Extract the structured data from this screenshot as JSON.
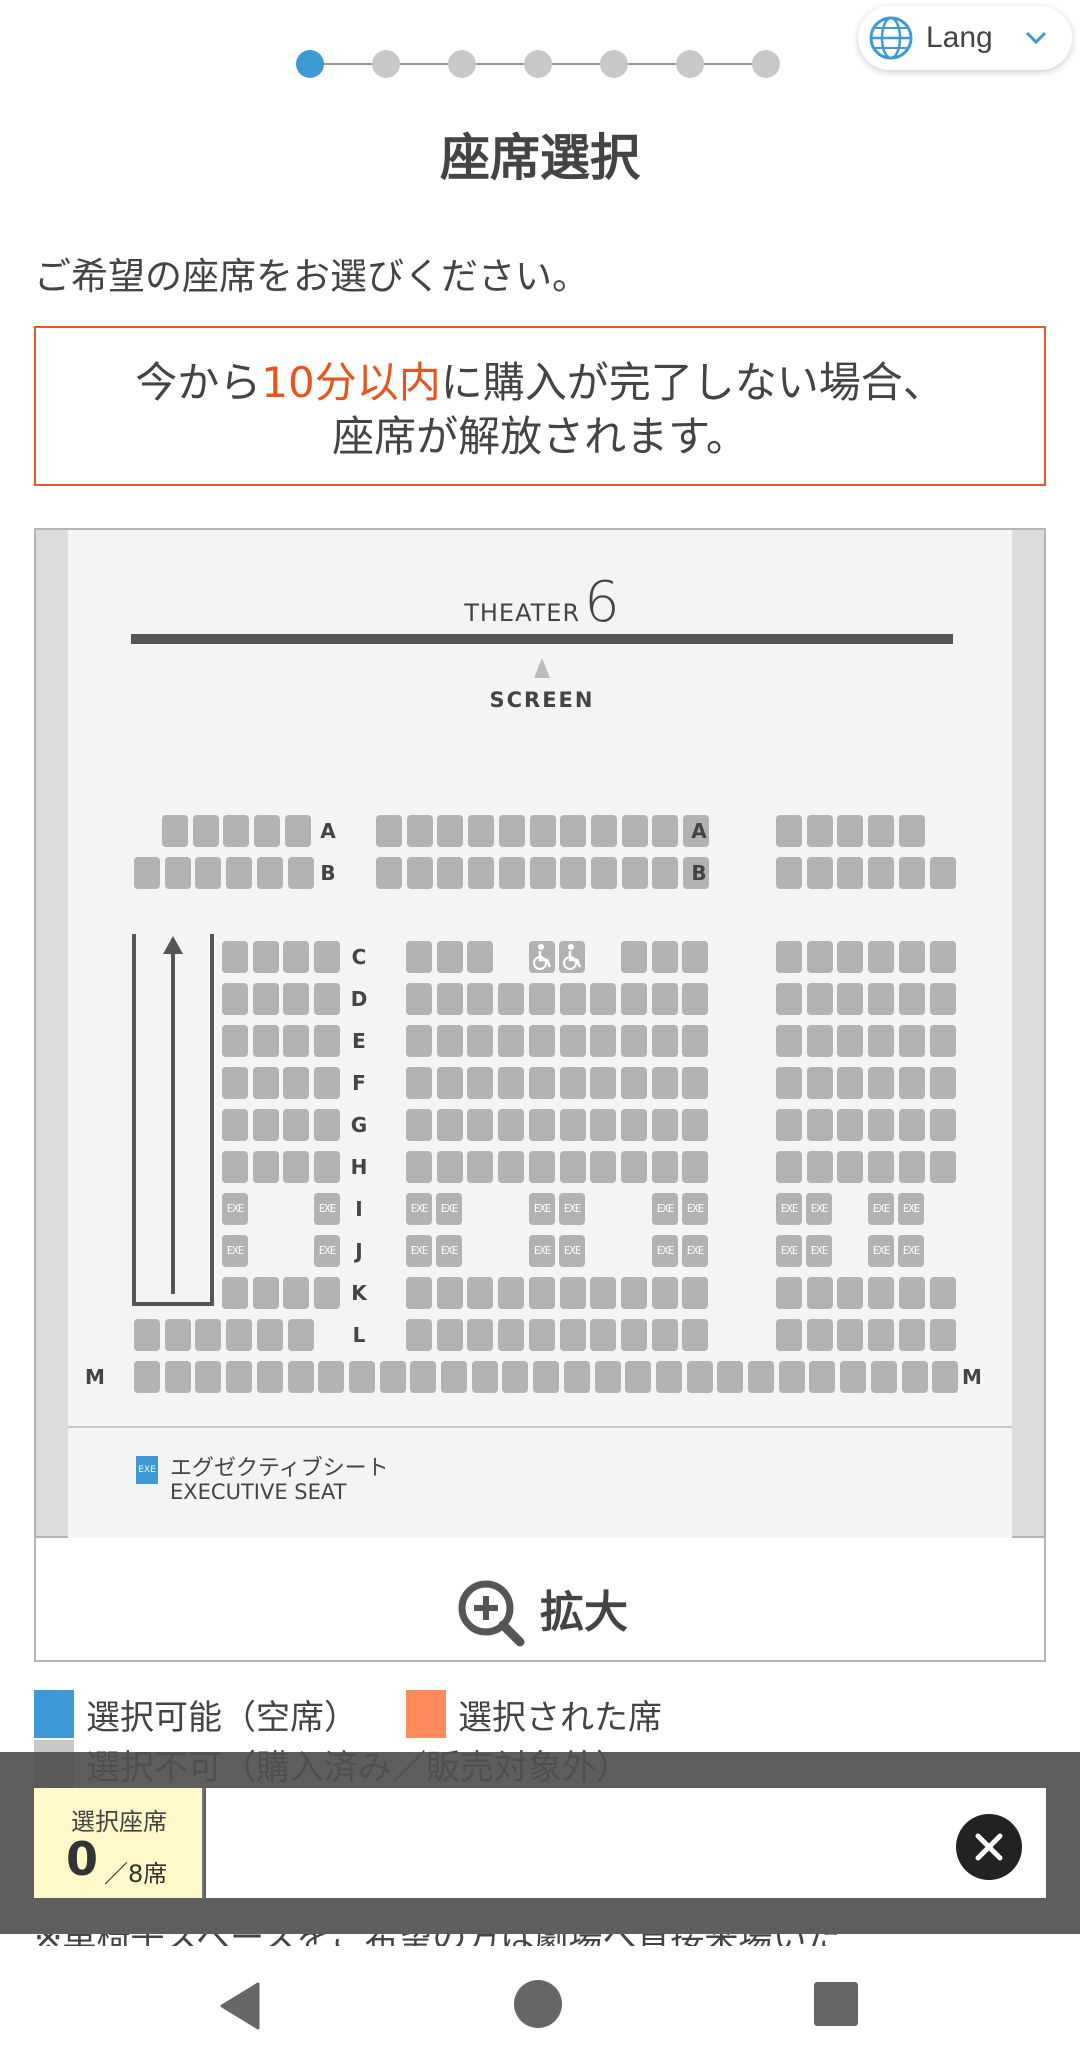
{
  "steps": {
    "count": 7,
    "active_index": 0
  },
  "lang": {
    "label": "Lang",
    "icon": "globe-icon"
  },
  "page": {
    "title": "座席選択",
    "instruction": "ご希望の座席をお選びください。"
  },
  "notice": {
    "before": "今から",
    "highlight": "10分以内",
    "after": "に購入が完了しない場合、",
    "line2": "座席が解放されます。"
  },
  "theater": {
    "label": "THEATER",
    "number": "6",
    "screen_label": "SCREEN",
    "rows": [
      "A",
      "B",
      "C",
      "D",
      "E",
      "F",
      "G",
      "H",
      "I",
      "J",
      "K",
      "L",
      "M"
    ],
    "exe_label": "EXE"
  },
  "legend": {
    "exe_jp": "エグゼクティブシート",
    "exe_en": "EXECUTIVE SEAT"
  },
  "zoom": {
    "label": "拡大"
  },
  "status_legend": {
    "available": "選択可能（空席）",
    "selected": "選択された席",
    "unavailable": "選択不可（購入済み／販売対象外）"
  },
  "colors": {
    "available": "#3e9ad6",
    "selected": "#ff8a5c",
    "unavailable": "#c8c8c8",
    "seat_gray": "#b2b2b2",
    "accent_orange": "#e8541c"
  },
  "selection": {
    "label": "選択座席",
    "count": "0",
    "total": "／8席"
  },
  "cut_text": "※車椅子スペースをご希望の方は劇場へ直接来場いた"
}
